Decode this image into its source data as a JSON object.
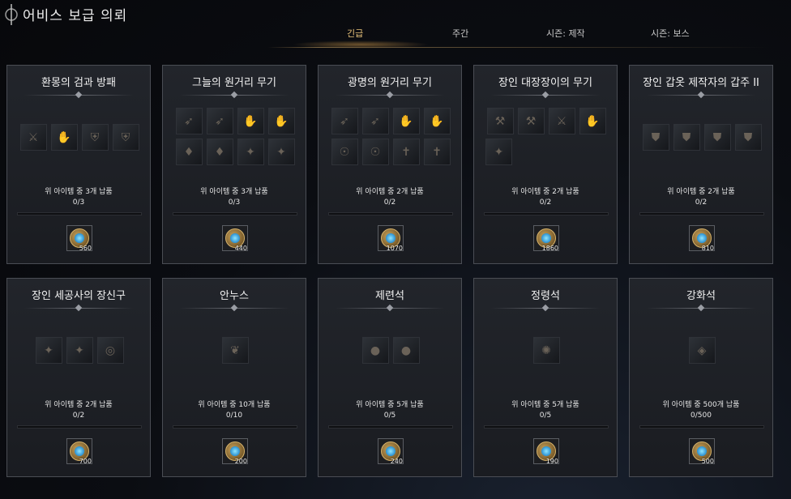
{
  "header": {
    "title": "어비스 보급 의뢰"
  },
  "tabs": [
    {
      "label": "긴급",
      "active": true
    },
    {
      "label": "주간",
      "active": false
    },
    {
      "label": "시즌: 제작",
      "active": false
    },
    {
      "label": "시즌: 보스",
      "active": false
    }
  ],
  "colors": {
    "accent": "#e8c27a",
    "card_border": "#4a4d54",
    "coin_gold": "#c9a35c",
    "coin_blue": "#2a8fd0"
  },
  "cards": [
    {
      "title": "환몽의 검과 방패",
      "items": [
        "blade-icon",
        "gauntlet-icon",
        "shield-icon",
        "shield-icon"
      ],
      "requirement": "위 아이템 중 3개 납품",
      "progress_text": "0/3",
      "progress": 0,
      "reward": "560"
    },
    {
      "title": "그늘의 원거리 무기",
      "items": [
        "bow-icon",
        "bow-icon",
        "gauntlet-icon",
        "gauntlet-icon",
        "spike-icon",
        "spike-icon",
        "claw-icon",
        "claw-icon"
      ],
      "requirement": "위 아이템 중 3개 납품",
      "progress_text": "0/3",
      "progress": 0,
      "reward": "440"
    },
    {
      "title": "광명의 원거리 무기",
      "items": [
        "bow-icon",
        "bow-icon",
        "gauntlet-icon",
        "gauntlet-icon",
        "mask-icon",
        "mask-icon",
        "cross-icon",
        "cross-icon"
      ],
      "requirement": "위 아이템 중 2개 납품",
      "progress_text": "0/2",
      "progress": 0,
      "reward": "1070"
    },
    {
      "title": "장인 대장장이의 무기",
      "items": [
        "axe-icon",
        "axe-icon",
        "blade-icon",
        "gauntlet-icon",
        "claw-icon"
      ],
      "requirement": "위 아이템 중 2개 납품",
      "progress_text": "0/2",
      "progress": 0,
      "reward": "1860"
    },
    {
      "title": "장인 갑옷 제작자의 갑주 II",
      "items": [
        "armor-icon",
        "armor-icon",
        "armor-icon",
        "armor-icon"
      ],
      "requirement": "위 아이템 중 2개 납품",
      "progress_text": "0/2",
      "progress": 0,
      "reward": "810"
    },
    {
      "title": "장인 세공사의 장신구",
      "items": [
        "claw-icon",
        "claw-icon",
        "ring-icon"
      ],
      "requirement": "위 아이템 중 2개 납품",
      "progress_text": "0/2",
      "progress": 0,
      "reward": "700"
    },
    {
      "title": "안누스",
      "items": [
        "feather-icon"
      ],
      "requirement": "위 아이템 중 10개 납품",
      "progress_text": "0/10",
      "progress": 0,
      "reward": "200"
    },
    {
      "title": "제련석",
      "items": [
        "orb-icon",
        "orb-icon"
      ],
      "requirement": "위 아이템 중 5개 납품",
      "progress_text": "0/5",
      "progress": 0,
      "reward": "240"
    },
    {
      "title": "정령석",
      "items": [
        "spirit-stone-icon"
      ],
      "requirement": "위 아이템 중 5개 납품",
      "progress_text": "0/5",
      "progress": 0,
      "reward": "190"
    },
    {
      "title": "강화석",
      "items": [
        "enhance-stone-icon"
      ],
      "requirement": "위 아이템 중 500개 납품",
      "progress_text": "0/500",
      "progress": 0,
      "reward": "500"
    }
  ]
}
